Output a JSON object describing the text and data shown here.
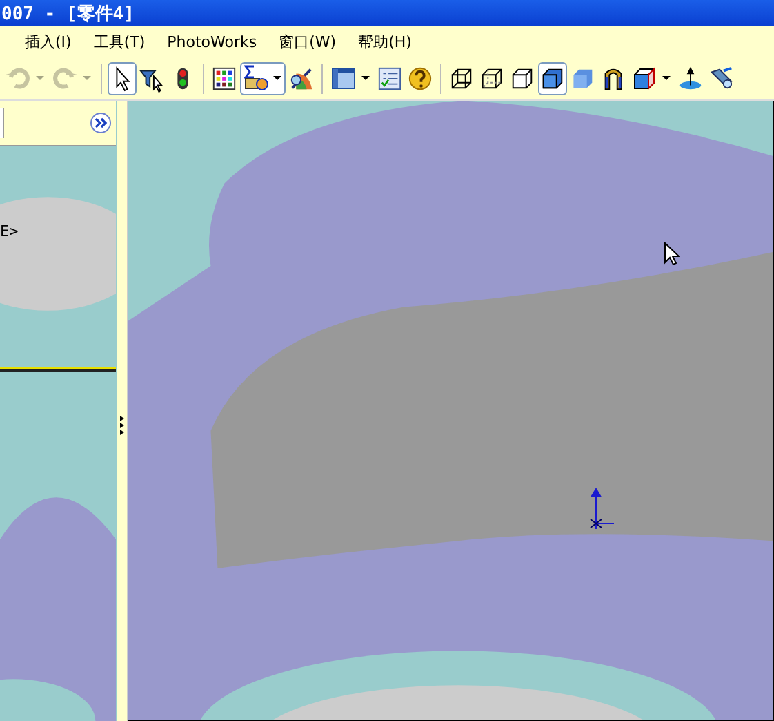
{
  "window": {
    "title": "007 - [零件4]"
  },
  "menu": [
    {
      "label": "插入(I)"
    },
    {
      "label": "工具(T)"
    },
    {
      "label": "PhotoWorks"
    },
    {
      "label": "窗口(W)"
    },
    {
      "label": "帮助(H)"
    }
  ],
  "toolbar": [
    {
      "kind": "undo",
      "disabled": true,
      "pressed": false,
      "dropdown": true
    },
    {
      "kind": "redo",
      "disabled": true,
      "pressed": false,
      "dropdown": true
    },
    {
      "kind": "sep"
    },
    {
      "kind": "select",
      "disabled": false,
      "pressed": true,
      "dropdown": false
    },
    {
      "kind": "filter",
      "disabled": false,
      "pressed": false,
      "dropdown": false
    },
    {
      "kind": "traffic",
      "disabled": false,
      "pressed": false,
      "dropdown": false
    },
    {
      "kind": "sep"
    },
    {
      "kind": "palette",
      "disabled": false,
      "pressed": false,
      "dropdown": false
    },
    {
      "kind": "equation",
      "disabled": false,
      "pressed": true,
      "dropdown": true
    },
    {
      "kind": "render",
      "disabled": false,
      "pressed": false,
      "dropdown": false
    },
    {
      "kind": "sep"
    },
    {
      "kind": "viewport",
      "disabled": false,
      "pressed": false,
      "dropdown": true
    },
    {
      "kind": "checklist",
      "disabled": false,
      "pressed": false,
      "dropdown": false
    },
    {
      "kind": "help",
      "disabled": false,
      "pressed": false,
      "dropdown": false
    },
    {
      "kind": "sep"
    },
    {
      "kind": "wireframe",
      "disabled": false,
      "pressed": false,
      "dropdown": false
    },
    {
      "kind": "hidden",
      "disabled": false,
      "pressed": false,
      "dropdown": false
    },
    {
      "kind": "removed",
      "disabled": false,
      "pressed": false,
      "dropdown": false
    },
    {
      "kind": "shadededges",
      "disabled": false,
      "pressed": true,
      "dropdown": false
    },
    {
      "kind": "shaded",
      "disabled": false,
      "pressed": false,
      "dropdown": false
    },
    {
      "kind": "section",
      "disabled": false,
      "pressed": false,
      "dropdown": false
    },
    {
      "kind": "orient",
      "disabled": false,
      "pressed": false,
      "dropdown": true
    },
    {
      "kind": "plane",
      "disabled": false,
      "pressed": false,
      "dropdown": false
    },
    {
      "kind": "light",
      "disabled": false,
      "pressed": false,
      "dropdown": false
    }
  ],
  "panel": {
    "tree_text": "E>"
  }
}
